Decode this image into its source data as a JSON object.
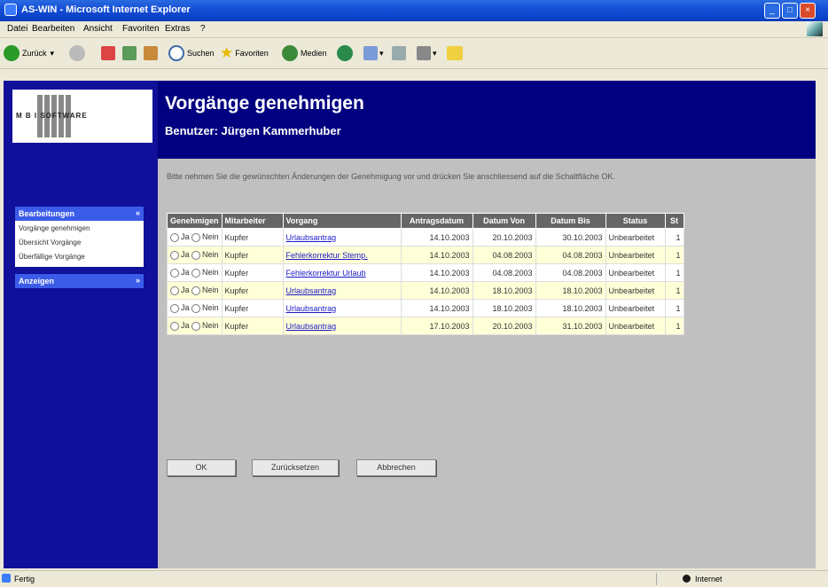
{
  "window": {
    "title": "AS-WIN - Microsoft Internet Explorer",
    "controls": [
      "_",
      "□",
      "×"
    ]
  },
  "menu": [
    "Datei",
    "Bearbeiten",
    "Ansicht",
    "Favoriten",
    "Extras",
    "?"
  ],
  "toolbar": {
    "back": "Zurück",
    "search": "Suchen",
    "favorites": "Favoriten",
    "media": "Medien"
  },
  "sidebar": {
    "logo_text": "M B I SOFTWARE",
    "nav": [
      {
        "label": "Bearbeitungen",
        "arrow": "«"
      },
      {
        "label": "Anzeigen",
        "arrow": "»"
      }
    ],
    "subitems": [
      "Vorgänge genehmigen",
      "Übersicht Vorgänge",
      "Überfällige Vorgänge"
    ]
  },
  "header": {
    "title": "Vorgänge genehmigen",
    "user": "Benutzer: Jürgen Kammerhuber"
  },
  "instructions": "Bitte nehmen Sie die gewünschten Änderungen der Genehmigung vor und drücken Sie anschliessend auf die Schaltfläche OK.",
  "table": {
    "columns": [
      "Genehmigen",
      "Mitarbeiter",
      "Vorgang",
      "Antragsdatum",
      "Datum Von",
      "Datum Bis",
      "Status",
      "St"
    ],
    "radio_labels": {
      "yes": "Ja",
      "no": "Nein"
    },
    "rows": [
      {
        "employee": "Kupfer",
        "process": "Urlaubsantrag",
        "applied": "14.10.2003",
        "from": "20.10.2003",
        "to": "30.10.2003",
        "status": "Unbearbeitet",
        "st": "1"
      },
      {
        "employee": "Kupfer",
        "process": "Fehlerkorrektur Stemp.",
        "applied": "14.10.2003",
        "from": "04.08.2003",
        "to": "04.08.2003",
        "status": "Unbearbeitet",
        "st": "1"
      },
      {
        "employee": "Kupfer",
        "process": "Fehlerkorrektur Urlaub",
        "applied": "14.10.2003",
        "from": "04.08.2003",
        "to": "04.08.2003",
        "status": "Unbearbeitet",
        "st": "1"
      },
      {
        "employee": "Kupfer",
        "process": "Urlaubsantrag",
        "applied": "14.10.2003",
        "from": "18.10.2003",
        "to": "18.10.2003",
        "status": "Unbearbeitet",
        "st": "1"
      },
      {
        "employee": "Kupfer",
        "process": "Urlaubsantrag",
        "applied": "14.10.2003",
        "from": "18.10.2003",
        "to": "18.10.2003",
        "status": "Unbearbeitet",
        "st": "1"
      },
      {
        "employee": "Kupfer",
        "process": "Urlaubsantrag",
        "applied": "17.10.2003",
        "from": "20.10.2003",
        "to": "31.10.2003",
        "status": "Unbearbeitet",
        "st": "1"
      }
    ]
  },
  "buttons": {
    "ok": "OK",
    "reset": "Zurücksetzen",
    "cancel": "Abbrechen"
  },
  "statusbar": {
    "left": "Fertig",
    "zone": "Internet"
  }
}
